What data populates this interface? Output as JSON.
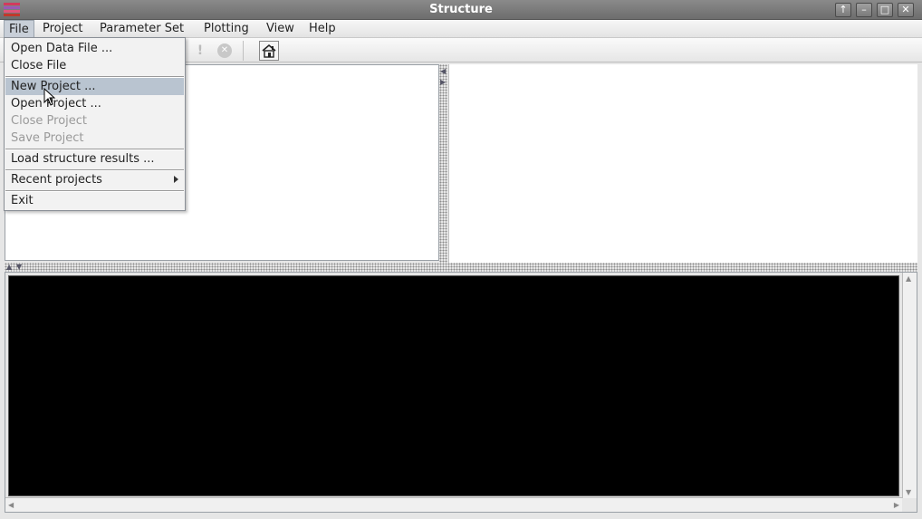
{
  "window": {
    "title": "Structure",
    "controls": [
      "↑",
      "–",
      "□",
      "✕"
    ]
  },
  "menubar": {
    "items": [
      "File",
      "Project",
      "Parameter Set",
      "Plotting",
      "View",
      "Help"
    ]
  },
  "file_menu": {
    "items": [
      {
        "label": "Open Data File ...",
        "enabled": true
      },
      {
        "label": "Close File",
        "enabled": true
      },
      {
        "label": "New Project ...",
        "enabled": true,
        "highlighted": true
      },
      {
        "label": "Open Project ...",
        "enabled": true
      },
      {
        "label": "Close Project",
        "enabled": false
      },
      {
        "label": "Save Project",
        "enabled": false
      },
      {
        "label": "Load structure results ...",
        "enabled": true
      },
      {
        "label": "Recent projects",
        "enabled": true,
        "submenu": true
      },
      {
        "label": "Exit",
        "enabled": true
      }
    ]
  },
  "toolbar": {
    "icons": [
      "exclamation-icon",
      "stop-icon",
      "home-icon"
    ],
    "glyphs": {
      "exclamation": "!",
      "stop": "✕",
      "home": "⌂"
    }
  },
  "colors": {
    "titlebar": "#7a7a7a",
    "console": "#000000",
    "menu_highlight": "#b9c4d0"
  }
}
